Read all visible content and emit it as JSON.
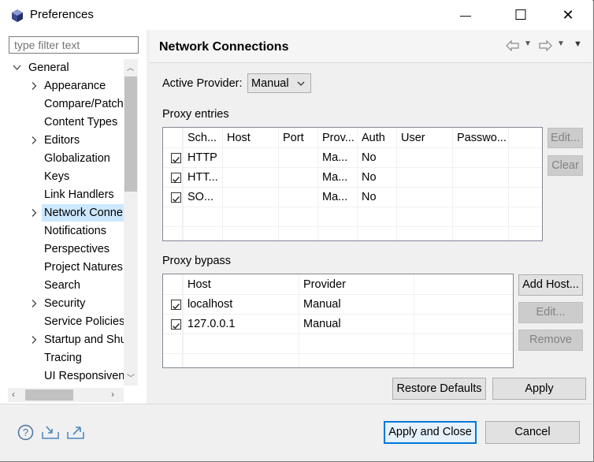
{
  "window": {
    "title": "Preferences",
    "minimize": "—",
    "maximize": "☐",
    "close": "✕"
  },
  "filter": {
    "placeholder": "type filter text"
  },
  "tree": {
    "items": [
      {
        "label": "General",
        "expanded": true
      },
      {
        "label": "Appearance",
        "expandable": true
      },
      {
        "label": "Compare/Patch"
      },
      {
        "label": "Content Types"
      },
      {
        "label": "Editors",
        "expandable": true
      },
      {
        "label": "Globalization"
      },
      {
        "label": "Keys"
      },
      {
        "label": "Link Handlers"
      },
      {
        "label": "Network Conne",
        "expandable": true,
        "selected": true
      },
      {
        "label": "Notifications"
      },
      {
        "label": "Perspectives"
      },
      {
        "label": "Project Natures"
      },
      {
        "label": "Search"
      },
      {
        "label": "Security",
        "expandable": true
      },
      {
        "label": "Service Policies"
      },
      {
        "label": "Startup and Shu",
        "expandable": true
      },
      {
        "label": "Tracing"
      },
      {
        "label": "UI Responsiven"
      }
    ]
  },
  "page": {
    "title": "Network Connections",
    "active_provider_label": "Active Provider:",
    "active_provider_value": "Manual",
    "proxy_entries_label": "Proxy entries",
    "proxy_bypass_label": "Proxy bypass"
  },
  "proxy_entries": {
    "columns": [
      "Sch...",
      "Host",
      "Port",
      "Prov...",
      "Auth",
      "User",
      "Passwo..."
    ],
    "rows": [
      {
        "checked": true,
        "scheme": "HTTP",
        "host": "",
        "port": "",
        "provider": "Ma...",
        "auth": "No",
        "user": "",
        "password": ""
      },
      {
        "checked": true,
        "scheme": "HTT...",
        "host": "",
        "port": "",
        "provider": "Ma...",
        "auth": "No",
        "user": "",
        "password": ""
      },
      {
        "checked": true,
        "scheme": "SO...",
        "host": "",
        "port": "",
        "provider": "Ma...",
        "auth": "No",
        "user": "",
        "password": ""
      }
    ],
    "edit_label": "Edit...",
    "clear_label": "Clear"
  },
  "proxy_bypass": {
    "columns": [
      "Host",
      "Provider"
    ],
    "rows": [
      {
        "checked": true,
        "host": "localhost",
        "provider": "Manual"
      },
      {
        "checked": true,
        "host": "127.0.0.1",
        "provider": "Manual"
      }
    ],
    "add_host_label": "Add Host...",
    "edit_label": "Edit...",
    "remove_label": "Remove"
  },
  "buttons": {
    "restore_defaults": "Restore Defaults",
    "apply": "Apply",
    "apply_and_close": "Apply and Close",
    "cancel": "Cancel"
  },
  "icons": {
    "help": "help-icon",
    "import": "import-icon",
    "export": "export-icon",
    "back": "back-arrow-icon",
    "forward": "forward-arrow-icon",
    "menu": "view-menu-icon"
  },
  "colors": {
    "selection": "#cce8ff",
    "accent_border": "#0078d7"
  }
}
